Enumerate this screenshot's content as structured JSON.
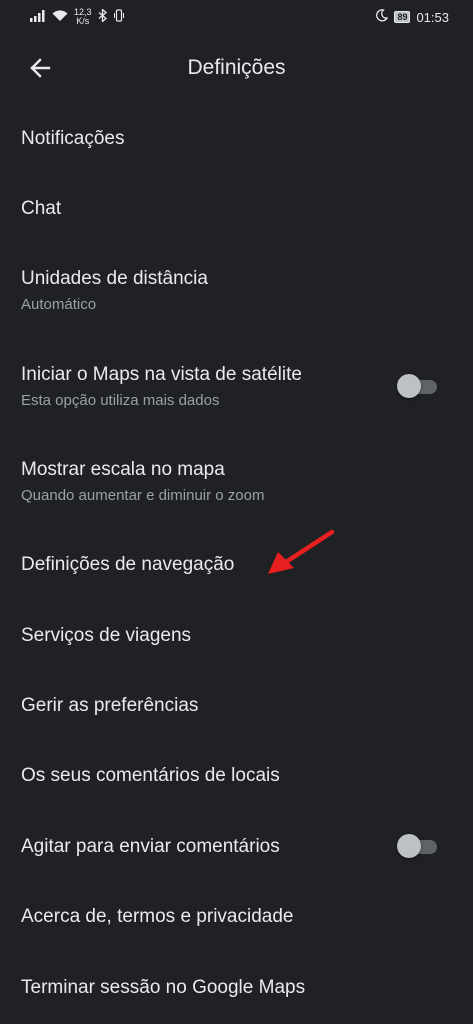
{
  "status_bar": {
    "net_speed_value": "12,3",
    "net_speed_unit": "K/s",
    "battery": "89",
    "time": "01:53",
    "icons": [
      "signal-icon",
      "wifi-icon",
      "bluetooth-icon",
      "vibrate-icon",
      "moon-icon",
      "battery-icon"
    ]
  },
  "app_bar": {
    "title": "Definições",
    "back_icon": "arrow-left-icon"
  },
  "items": [
    {
      "title": "Notificações"
    },
    {
      "title": "Chat"
    },
    {
      "title": "Unidades de distância",
      "subtitle": "Automático"
    },
    {
      "title": "Iniciar o Maps na vista de satélite",
      "subtitle": "Esta opção utiliza mais dados",
      "toggle_on": false
    },
    {
      "title": "Mostrar escala no mapa",
      "subtitle": "Quando aumentar e diminuir o zoom"
    },
    {
      "title": "Definições de navegação"
    },
    {
      "title": "Serviços de viagens"
    },
    {
      "title": "Gerir as preferências"
    },
    {
      "title": "Os seus comentários de locais"
    },
    {
      "title": "Agitar para enviar comentários",
      "toggle_on": false
    },
    {
      "title": "Acerca de, termos e privacidade"
    },
    {
      "title": "Terminar sessão no Google Maps"
    }
  ],
  "colors": {
    "background": "#202124",
    "text_primary": "#e8eaed",
    "text_secondary": "#9aa0a6",
    "annotation_arrow": "#e8201f"
  }
}
